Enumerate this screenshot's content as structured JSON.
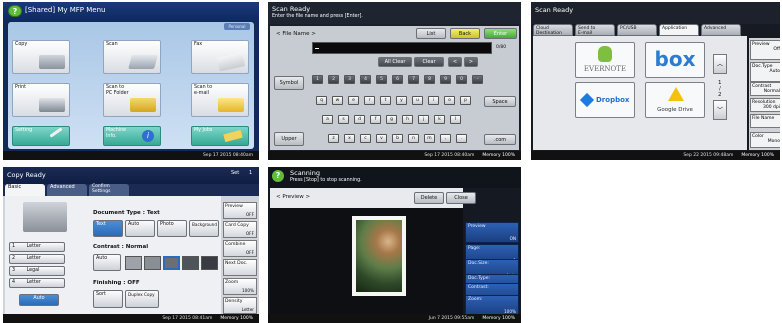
{
  "panel1": {
    "help_label": "?",
    "title": "[Shared] My MFP Menu",
    "top_right_badge": "Personal",
    "buttons": [
      {
        "label": "Copy"
      },
      {
        "label": "Scan"
      },
      {
        "label": "Fax"
      },
      {
        "label": "Print"
      },
      {
        "label": "Scan to\nPC Folder"
      },
      {
        "label": "Scan to\ne-mail"
      },
      {
        "label": "Setting"
      },
      {
        "label": "Machine\nInfo."
      },
      {
        "label": "My Jobs"
      }
    ],
    "status": "Sep 17 2015 08:40am"
  },
  "panel2": {
    "title": "Scan Ready",
    "subtitle": "Enter the file name and press [Enter].",
    "file_name_label": "< File Name >",
    "list_button": "List",
    "back_button": "Back",
    "enter_button": "Enter",
    "counter": "0/80",
    "all_clear": "All Clear",
    "clear": "Clear",
    "left_arrow": "<",
    "right_arrow": ">",
    "symbol_button": "Symbol",
    "space_button": "Space",
    "dotcom_button": ".com",
    "upper_button": "Upper",
    "row1": [
      "1",
      "2",
      "3",
      "4",
      "5",
      "6",
      "7",
      "8",
      "9",
      "0",
      "-"
    ],
    "row2": [
      "q",
      "w",
      "e",
      "r",
      "t",
      "y",
      "u",
      "i",
      "o",
      "p"
    ],
    "row3": [
      "a",
      "s",
      "d",
      "f",
      "g",
      "h",
      "j",
      "k",
      "l"
    ],
    "row4": [
      "z",
      "x",
      "c",
      "v",
      "b",
      "n",
      "m",
      ",",
      "."
    ],
    "status_date": "Sep 17 2015 08:40am",
    "status_mem": "Memory 100%"
  },
  "panel3": {
    "title": "Scan Ready",
    "tabs": [
      "Cloud\nDestination",
      "Send to\nE-mail",
      "PC/USB",
      "Application",
      "Advanced"
    ],
    "apps": [
      "EVERNOTE",
      "box",
      "Dropbox",
      "Google Drive"
    ],
    "page_indicator": [
      "1",
      "/",
      "2"
    ],
    "side": [
      {
        "label": "Preview",
        "value": "Off"
      },
      {
        "label": "Doc.Type",
        "value": "Auto"
      },
      {
        "label": "Contrast",
        "value": "Normal"
      },
      {
        "label": "Resolution",
        "value": "300 dpi"
      },
      {
        "label": "File Name",
        "value": ""
      },
      {
        "label": "Color",
        "value": "Mono"
      }
    ],
    "status_date": "Sep 22 2015 09:48am",
    "status_mem": "Memory 100%"
  },
  "panel4": {
    "title": "Copy Ready",
    "set_label": "Set",
    "set_count": "1",
    "tabs": [
      "Basic",
      "Advanced",
      "Confirm\nSettings"
    ],
    "doc_type_label": "Document Type : Text",
    "doc_types": [
      "Text",
      "Auto",
      "Photo",
      "Background"
    ],
    "contrast_label": "Contrast     : Normal",
    "contrast_auto": "Auto",
    "finishing_label": "Finishing    : OFF",
    "sort_label": "Sort",
    "duplex_label": "Duplex Copy",
    "trays": [
      {
        "num": "1",
        "label": "Letter"
      },
      {
        "num": "2",
        "label": "Letter"
      },
      {
        "num": "3",
        "label": "Legal"
      },
      {
        "num": "4",
        "label": "Letter"
      }
    ],
    "auto_tray": "Auto",
    "side": [
      {
        "label": "Preview",
        "value": "OFF"
      },
      {
        "label": "Card Copy",
        "value": "OFF"
      },
      {
        "label": "Combine",
        "value": "OFF"
      },
      {
        "label": "Next Doc.",
        "value": ""
      },
      {
        "label": "Zoom",
        "value": "100%"
      },
      {
        "label": "Density",
        "value": "Letter"
      }
    ],
    "status_date": "Sep 17 2015 08:41am",
    "status_mem": "Memory 100%"
  },
  "panel5": {
    "title": "Scanning",
    "subtitle": "Press [Stop] to stop scanning.",
    "preview_label": "< Preview >",
    "delete_button": "Delete",
    "close_button": "Close",
    "side": [
      {
        "label": "Preview",
        "value": "ON"
      },
      {
        "label": "Page:",
        "value": "1"
      },
      {
        "label": "Doc.Size:",
        "value": "Auto"
      },
      {
        "label": "Doc.Type:",
        "value": "Auto"
      },
      {
        "label": "Contrast:",
        "value": "Normal"
      },
      {
        "label": "Zoom:",
        "value": "100%"
      }
    ],
    "status_date": "Jun 7 2015 09:55am",
    "status_mem": "Memory 100%"
  }
}
